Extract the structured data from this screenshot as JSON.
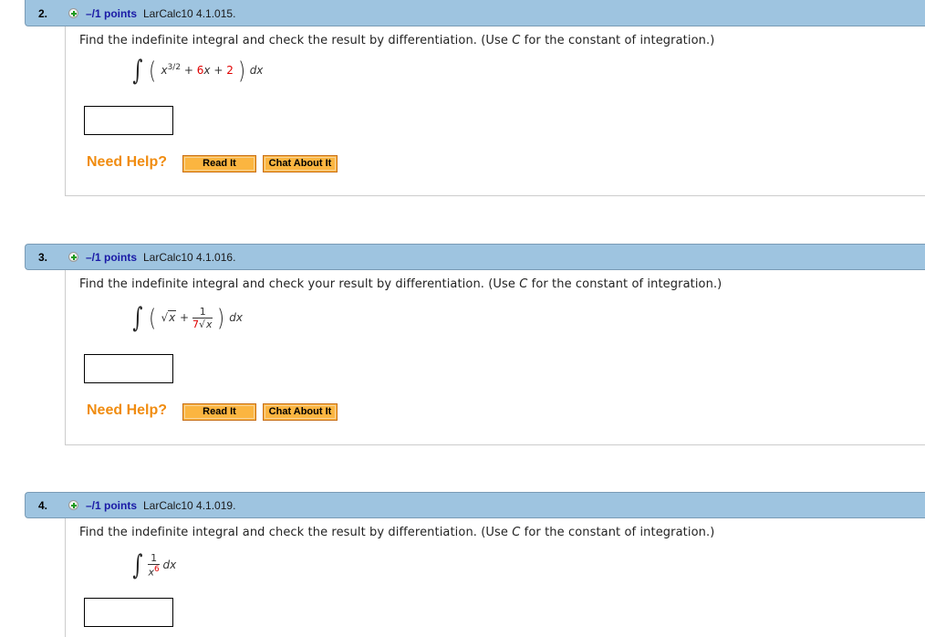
{
  "questions": [
    {
      "number": "2.",
      "points": "–/1 points",
      "id": "LarCalc10 4.1.015.",
      "prompt_pre": "Find the indefinite integral and check the result by differentiation. (Use ",
      "prompt_var": "C",
      "prompt_post": " for the constant of integration.)",
      "expression": {
        "x": "x",
        "exp": "3/2",
        "plus1": "+",
        "coef": "6",
        "x2": "x",
        "plus2": "+",
        "const": "2",
        "dx": "dx"
      },
      "answer_value": "",
      "help_label": "Need Help?",
      "read_label": "Read It",
      "chat_label": "Chat About It"
    },
    {
      "number": "3.",
      "points": "–/1 points",
      "id": "LarCalc10 4.1.016.",
      "prompt_pre": "Find the indefinite integral and check your result by differentiation. (Use ",
      "prompt_var": "C",
      "prompt_post": " for the constant of integration.)",
      "expression": {
        "rad": "x",
        "plus": "+",
        "num": "1",
        "coef": "7",
        "den_rad": "x",
        "dx": "dx"
      },
      "answer_value": "",
      "help_label": "Need Help?",
      "read_label": "Read It",
      "chat_label": "Chat About It"
    },
    {
      "number": "4.",
      "points": "–/1 points",
      "id": "LarCalc10 4.1.019.",
      "prompt_pre": "Find the indefinite integral and check the result by differentiation. (Use ",
      "prompt_var": "C",
      "prompt_post": " for the constant of integration.)",
      "expression": {
        "num": "1",
        "x": "x",
        "exp": "6",
        "dx": "dx"
      },
      "answer_value": ""
    }
  ],
  "symbols": {
    "integral": "∫",
    "lparen": "(",
    "rparen": ")",
    "sqrt": "√"
  },
  "colors": {
    "header_bg": "#9ec4e0",
    "points_text": "#1a1aa6",
    "help_text": "#f08c10",
    "button_bg": "#fbb540",
    "param_red": "#e00000"
  }
}
